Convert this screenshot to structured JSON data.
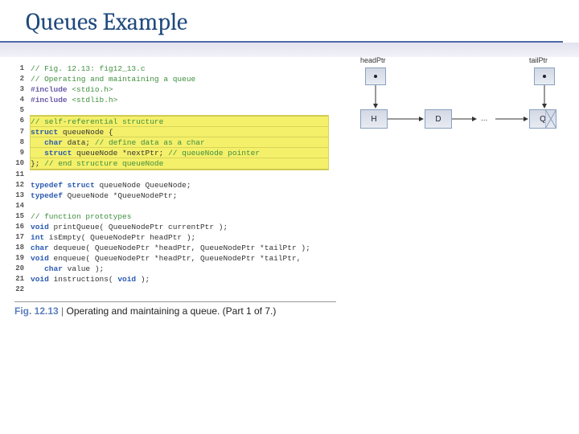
{
  "slide": {
    "title": "Queues Example"
  },
  "code": {
    "lines": [
      {
        "n": "1",
        "plain": "// Fig. 12.13: fig12_13.c",
        "cls": "cmt"
      },
      {
        "n": "2",
        "plain": "// Operating and maintaining a queue",
        "cls": "cmt"
      },
      {
        "n": "3",
        "html": "<span class='pp'>#include</span> <span class='cmt'>&lt;stdio.h&gt;</span>"
      },
      {
        "n": "4",
        "html": "<span class='pp'>#include</span> <span class='cmt'>&lt;stdlib.h&gt;</span>"
      },
      {
        "n": "5",
        "plain": ""
      },
      {
        "n": "6",
        "plain": "// self-referential structure",
        "cls": "cmt",
        "hl": "top"
      },
      {
        "n": "7",
        "html": "<span class='kw'>struct</span> queueNode {",
        "hl": "mid"
      },
      {
        "n": "8",
        "html": "   <span class='kw'>char</span> data; <span class='cmt'>// define data as a char</span>",
        "hl": "mid"
      },
      {
        "n": "9",
        "html": "   <span class='kw'>struct</span> queueNode *nextPtr; <span class='cmt'>// queueNode pointer</span>",
        "hl": "mid"
      },
      {
        "n": "10",
        "html": "}; <span class='cmt'>// end structure queueNode</span>",
        "hl": "bot"
      },
      {
        "n": "11",
        "plain": ""
      },
      {
        "n": "12",
        "html": "<span class='kw'>typedef struct</span> queueNode QueueNode;"
      },
      {
        "n": "13",
        "html": "<span class='kw'>typedef</span> QueueNode *QueueNodePtr;"
      },
      {
        "n": "14",
        "plain": ""
      },
      {
        "n": "15",
        "plain": "// function prototypes",
        "cls": "cmt"
      },
      {
        "n": "16",
        "html": "<span class='kw'>void</span> printQueue( QueueNodePtr currentPtr );"
      },
      {
        "n": "17",
        "html": "<span class='kw'>int</span> isEmpty( QueueNodePtr headPtr );"
      },
      {
        "n": "18",
        "html": "<span class='kw'>char</span> dequeue( QueueNodePtr *headPtr, QueueNodePtr *tailPtr );"
      },
      {
        "n": "19",
        "html": "<span class='kw'>void</span> enqueue( QueueNodePtr *headPtr, QueueNodePtr *tailPtr,"
      },
      {
        "n": "20",
        "html": "   <span class='kw'>char</span> value );"
      },
      {
        "n": "21",
        "html": "<span class='kw'>void</span> instructions( <span class='kw'>void</span> );"
      },
      {
        "n": "22",
        "plain": ""
      }
    ]
  },
  "caption": {
    "fig": "Fig. 12.13",
    "sep": "|",
    "text": "Operating and maintaining a queue. (Part 1 of 7.)"
  },
  "diagram": {
    "headLabel": "headPtr",
    "tailLabel": "tailPtr",
    "nodes": [
      "H",
      "D",
      "Q"
    ],
    "ellipsis": "..."
  }
}
